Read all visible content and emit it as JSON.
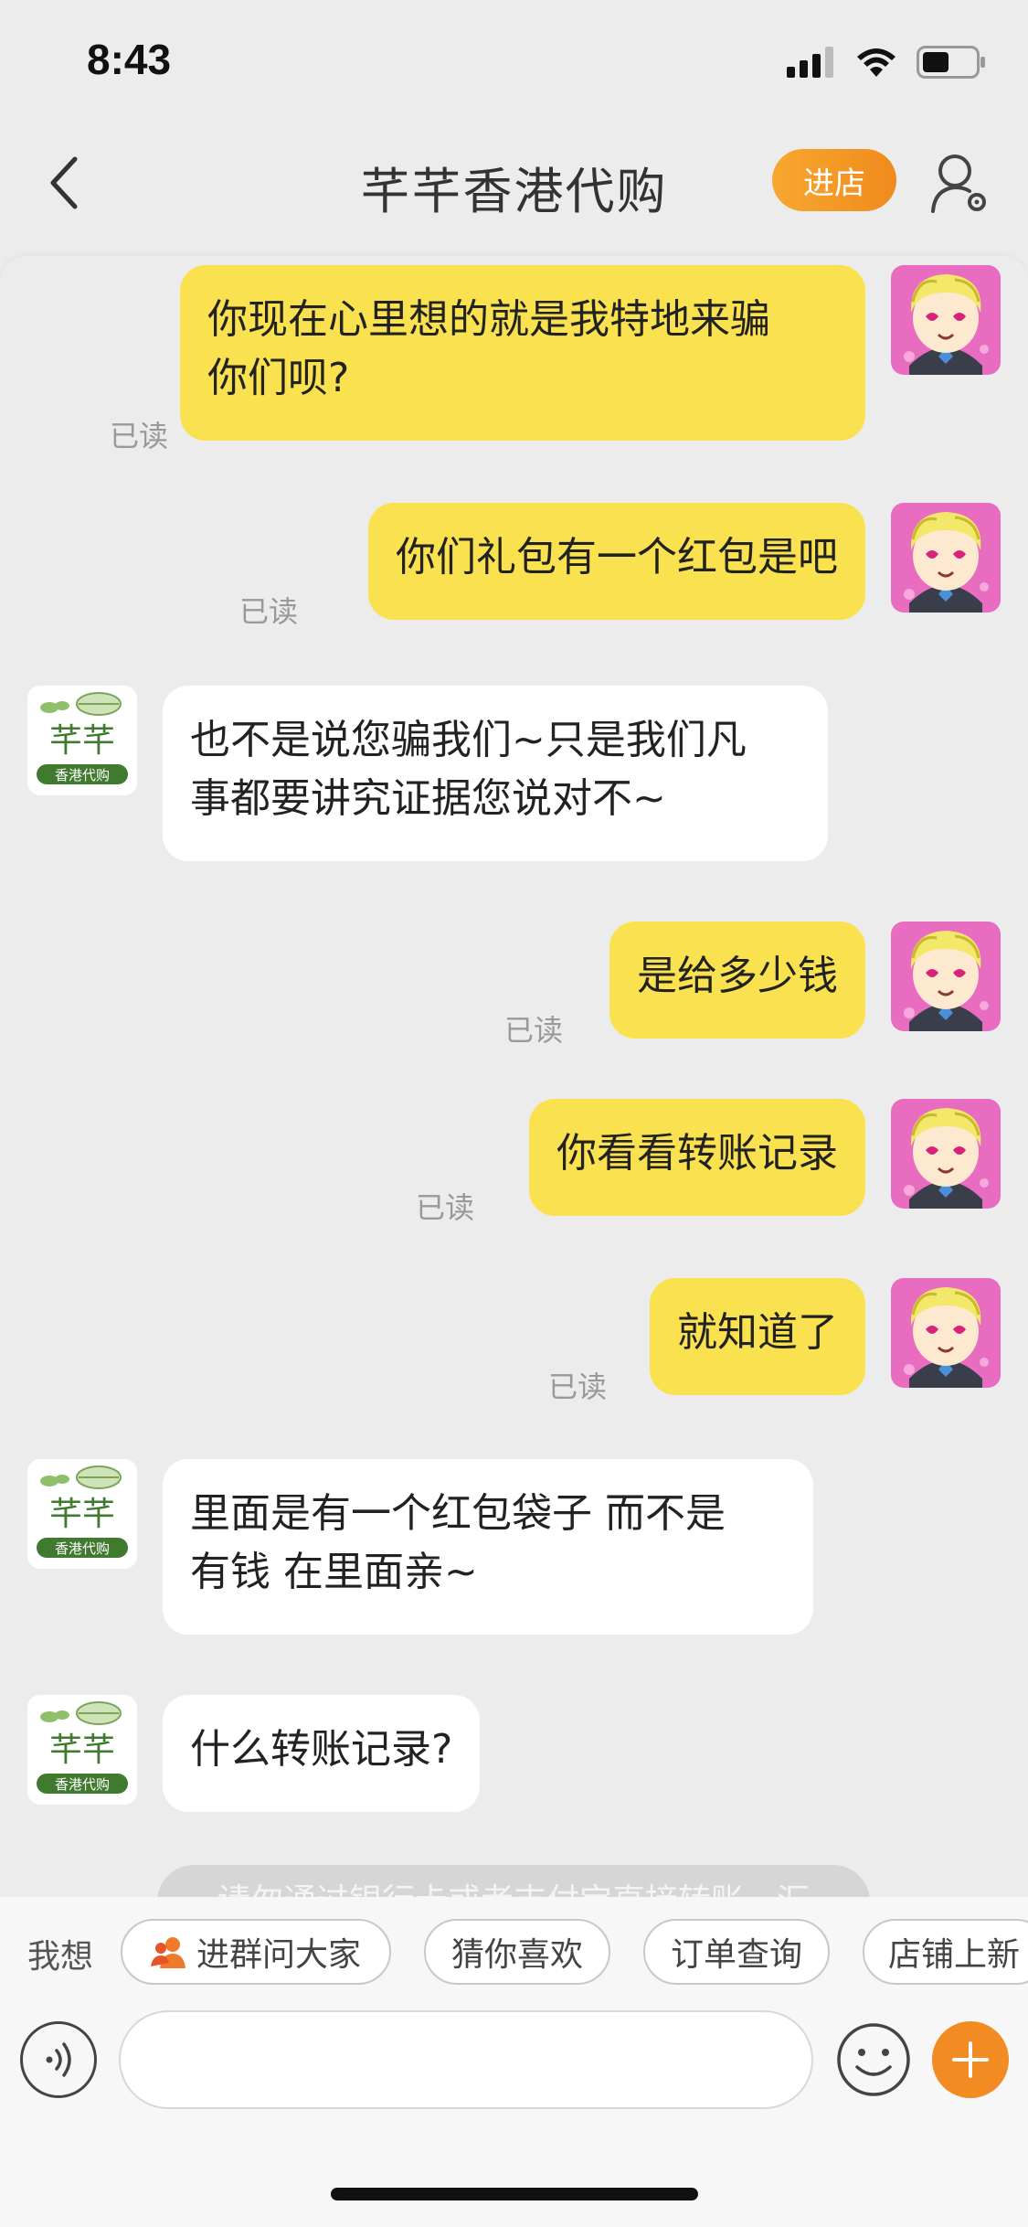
{
  "status_bar": {
    "time": "8:43",
    "icons": [
      "cellular-signal-icon",
      "wifi-icon",
      "battery-icon"
    ]
  },
  "nav": {
    "title": "芊芊香港代购",
    "shop_button": "进店",
    "icons": [
      "back-chevron-icon",
      "profile-settings-icon"
    ]
  },
  "colors": {
    "user_bubble": "#fae14f",
    "shop_bubble": "#ffffff",
    "accent_orange": "#f28b22",
    "background": "#ececec"
  },
  "shop_avatar": {
    "line1": "芊芊",
    "line2": "香港代购"
  },
  "messages": [
    {
      "from": "user",
      "text": "你现在心里想的就是我特地来骗\n你们呗?",
      "status": "已读"
    },
    {
      "from": "user",
      "text": "你们礼包有一个红包是吧",
      "status": "已读"
    },
    {
      "from": "shop",
      "text": "也不是说您骗我们~只是我们凡\n事都要讲究证据您说对不~"
    },
    {
      "from": "user",
      "text": "是给多少钱",
      "status": "已读"
    },
    {
      "from": "user",
      "text": "你看看转账记录",
      "status": "已读"
    },
    {
      "from": "user",
      "text": "就知道了",
      "status": "已读"
    },
    {
      "from": "shop",
      "text": "里面是有一个红包袋子 而不是\n有钱 在里面亲~"
    },
    {
      "from": "shop",
      "text": "什么转账记录?"
    }
  ],
  "system_notice": "请勿通过银行卡或者支付宝直接转账，汇",
  "quick_bar": {
    "label": "我想",
    "chips": [
      "进群问大家",
      "猜你喜欢",
      "订单查询",
      "店铺上新"
    ]
  },
  "input": {
    "placeholder": ""
  }
}
